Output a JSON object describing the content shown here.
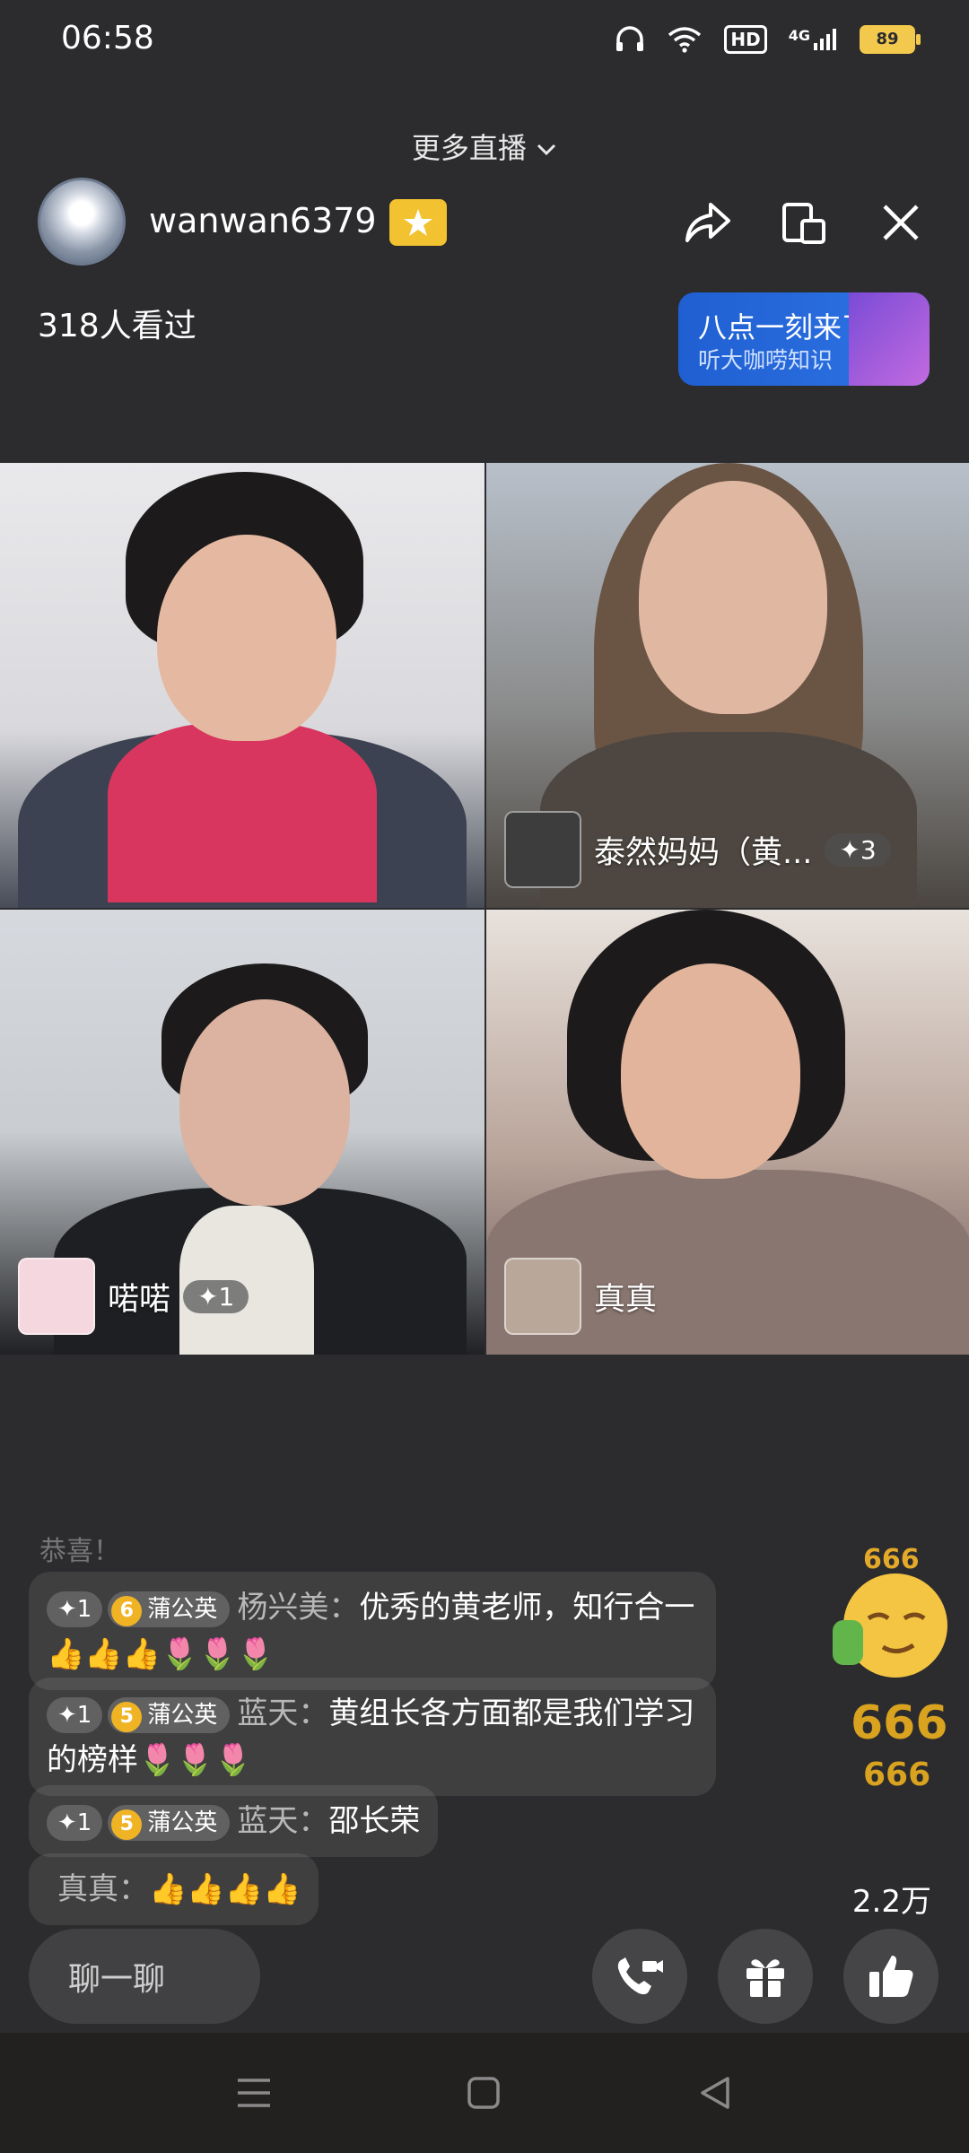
{
  "status_bar": {
    "time": "06:58",
    "network": "4G",
    "hd": "HD",
    "battery": "89"
  },
  "header": {
    "more_live": "更多直播",
    "host_name": "wanwan6379",
    "viewers": "318人看过",
    "promo": {
      "title": "八点一刻来了",
      "subtitle": "听大咖唠知识"
    }
  },
  "guests": [
    {
      "name": "泰然妈妈（黄...",
      "likes": "✦3"
    },
    {
      "name": "喏喏",
      "likes": "✦1"
    },
    {
      "name": "真真"
    }
  ],
  "comments": {
    "faded": "恭喜！",
    "items": [
      {
        "like": "✦1",
        "level": "6",
        "badge": "蒲公英",
        "user": "杨兴美：",
        "text": "优秀的黄老师，知行合一👍👍👍🌷🌷🌷"
      },
      {
        "like": "✦1",
        "level": "5",
        "badge": "蒲公英",
        "user": "蓝天：",
        "text": "黄组长各方面都是我们学习的榜样🌷🌷🌷"
      },
      {
        "like": "✦1",
        "level": "5",
        "badge": "蒲公英",
        "user": "蓝天：",
        "text": "邵长荣"
      },
      {
        "user": "真真：",
        "text": "👍👍👍👍"
      }
    ]
  },
  "likes_count": "2.2万",
  "bottom_bar": {
    "chat_placeholder": "聊一聊"
  },
  "emoji_text": "666",
  "colors": {
    "background": "#2c2c2e",
    "vip": "#f2c230",
    "promo": "#2f74e6",
    "badge": "#f0b323"
  }
}
